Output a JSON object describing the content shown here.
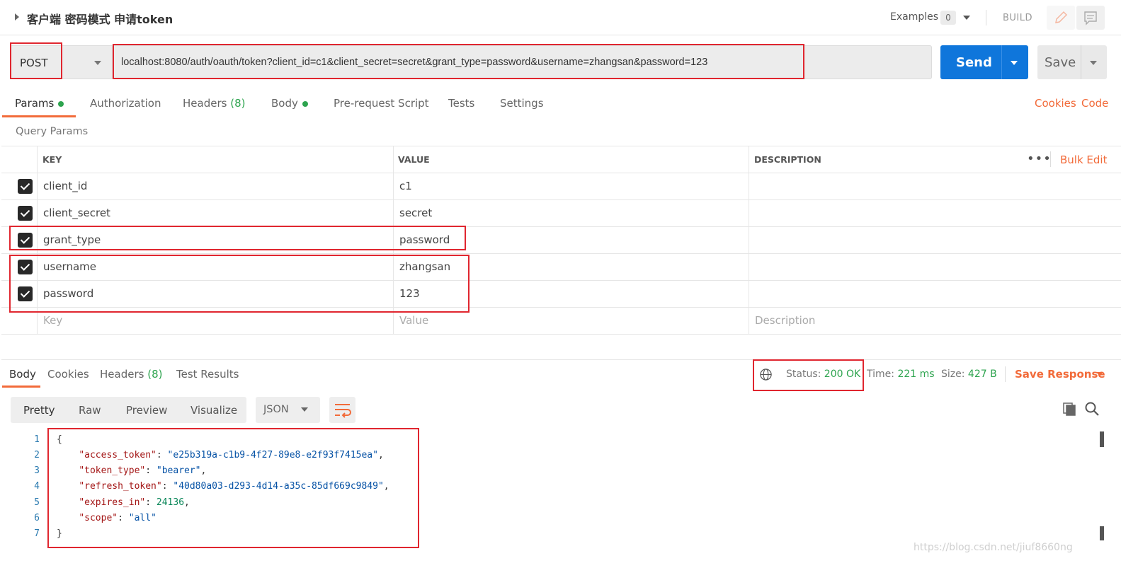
{
  "header": {
    "title": "客户端 密码模式 申请token",
    "examples_label": "Examples",
    "examples_count": "0",
    "build_label": "BUILD"
  },
  "request": {
    "method": "POST",
    "url": "localhost:8080/auth/oauth/token?client_id=c1&client_secret=secret&grant_type=password&username=zhangsan&password=123",
    "send_label": "Send",
    "save_label": "Save"
  },
  "tabs": {
    "params": "Params",
    "authorization": "Authorization",
    "headers": "Headers",
    "headers_count": "(8)",
    "body": "Body",
    "prerequest": "Pre-request Script",
    "tests": "Tests",
    "settings": "Settings",
    "cookies": "Cookies",
    "code": "Code"
  },
  "query_params": {
    "label": "Query Params",
    "columns": {
      "key": "KEY",
      "value": "VALUE",
      "description": "DESCRIPTION"
    },
    "more": "•••",
    "bulk_edit": "Bulk Edit",
    "rows": [
      {
        "key": "client_id",
        "value": "c1"
      },
      {
        "key": "client_secret",
        "value": "secret"
      },
      {
        "key": "grant_type",
        "value": "password"
      },
      {
        "key": "username",
        "value": "zhangsan"
      },
      {
        "key": "password",
        "value": "123"
      }
    ],
    "placeholders": {
      "key": "Key",
      "value": "Value",
      "description": "Description"
    }
  },
  "response": {
    "tabs": {
      "body": "Body",
      "cookies": "Cookies",
      "headers": "Headers",
      "headers_count": "(8)",
      "test_results": "Test Results"
    },
    "status_label": "Status:",
    "status_value": "200 OK",
    "time_label": "Time:",
    "time_value": "221 ms",
    "size_label": "Size:",
    "size_value": "427 B",
    "save_response": "Save Response",
    "views": {
      "pretty": "Pretty",
      "raw": "Raw",
      "preview": "Preview",
      "visualize": "Visualize"
    },
    "format": "JSON",
    "lines": [
      {
        "num": "1",
        "text": "{"
      },
      {
        "num": "2",
        "key": "\"access_token\"",
        "value": "\"e25b319a-c1b9-4f27-89e8-e2f93f7415ea\""
      },
      {
        "num": "3",
        "key": "\"token_type\"",
        "value": "\"bearer\""
      },
      {
        "num": "4",
        "key": "\"refresh_token\"",
        "value": "\"40d80a03-d293-4d14-a35c-85df669c9849\""
      },
      {
        "num": "5",
        "key": "\"expires_in\"",
        "value": "24136"
      },
      {
        "num": "6",
        "key": "\"scope\"",
        "value": "\"all\""
      },
      {
        "num": "7",
        "text": "}"
      }
    ]
  },
  "watermark": "https://blog.csdn.net/jiuf8660ng",
  "colors": {
    "accent": "#f26b3a",
    "send_button": "#0f76db",
    "success": "#2ea44f",
    "annotation_box": "#e0262f"
  }
}
